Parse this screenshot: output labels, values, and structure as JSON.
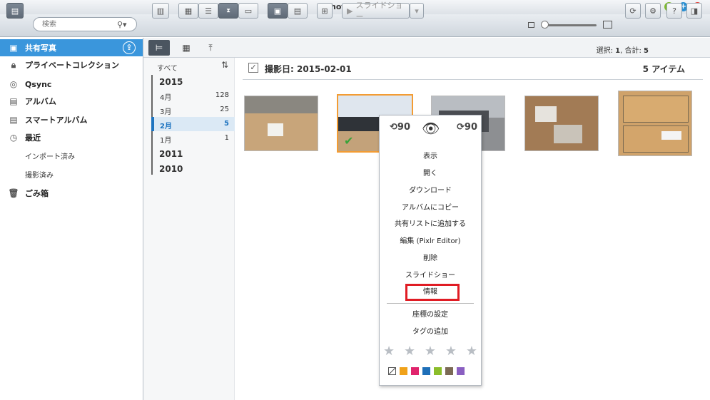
{
  "app": {
    "title": "Photo Station"
  },
  "colors": {
    "accent": "#3a96dc",
    "selected_border": "#f39c33",
    "highlight": "#e01c24"
  },
  "toolbar": {
    "search_placeholder": "検索",
    "slideshow_label": "スライドショー"
  },
  "sidebar": {
    "items": [
      {
        "label": "共有写真",
        "icon": "shared-photo-icon"
      },
      {
        "label": "プライベートコレクション",
        "icon": "lock-icon"
      },
      {
        "label": "Qsync",
        "icon": "qsync-icon"
      },
      {
        "label": "アルバム",
        "icon": "album-icon"
      },
      {
        "label": "スマートアルバム",
        "icon": "smart-album-icon"
      },
      {
        "label": "最近",
        "icon": "clock-icon"
      },
      {
        "label": "ごみ箱",
        "icon": "trash-icon"
      }
    ],
    "recent_sub": [
      "インポート済み",
      "撮影済み"
    ]
  },
  "status": {
    "select_label": "選択:",
    "selected": "1",
    "total_label": ", 合計:",
    "total": "5"
  },
  "timeline": {
    "all_label": "すべて",
    "years": [
      "2015",
      "2011",
      "2010"
    ],
    "months": [
      {
        "label": "4月",
        "count": "128"
      },
      {
        "label": "3月",
        "count": "25"
      },
      {
        "label": "2月",
        "count": "5"
      },
      {
        "label": "1月",
        "count": "1"
      }
    ]
  },
  "main": {
    "group_title": "撮影日: 2015-02-01",
    "item_count": "5 アイテム"
  },
  "context_menu": {
    "rotate_left": "90",
    "rotate_right": "90",
    "items": [
      "表示",
      "開く",
      "ダウンロード",
      "アルバムにコピー",
      "共有リストに追加する",
      "編集 (Pixlr Editor)",
      "削除",
      "スライドショー",
      "情報"
    ],
    "items2": [
      "座標の設定",
      "タグの追加"
    ],
    "rating": 0,
    "color_labels": [
      "#f0a21a",
      "#e0246c",
      "#1e6fb8",
      "#8bbd2a",
      "#7b6a55",
      "#8a5fc1"
    ]
  }
}
